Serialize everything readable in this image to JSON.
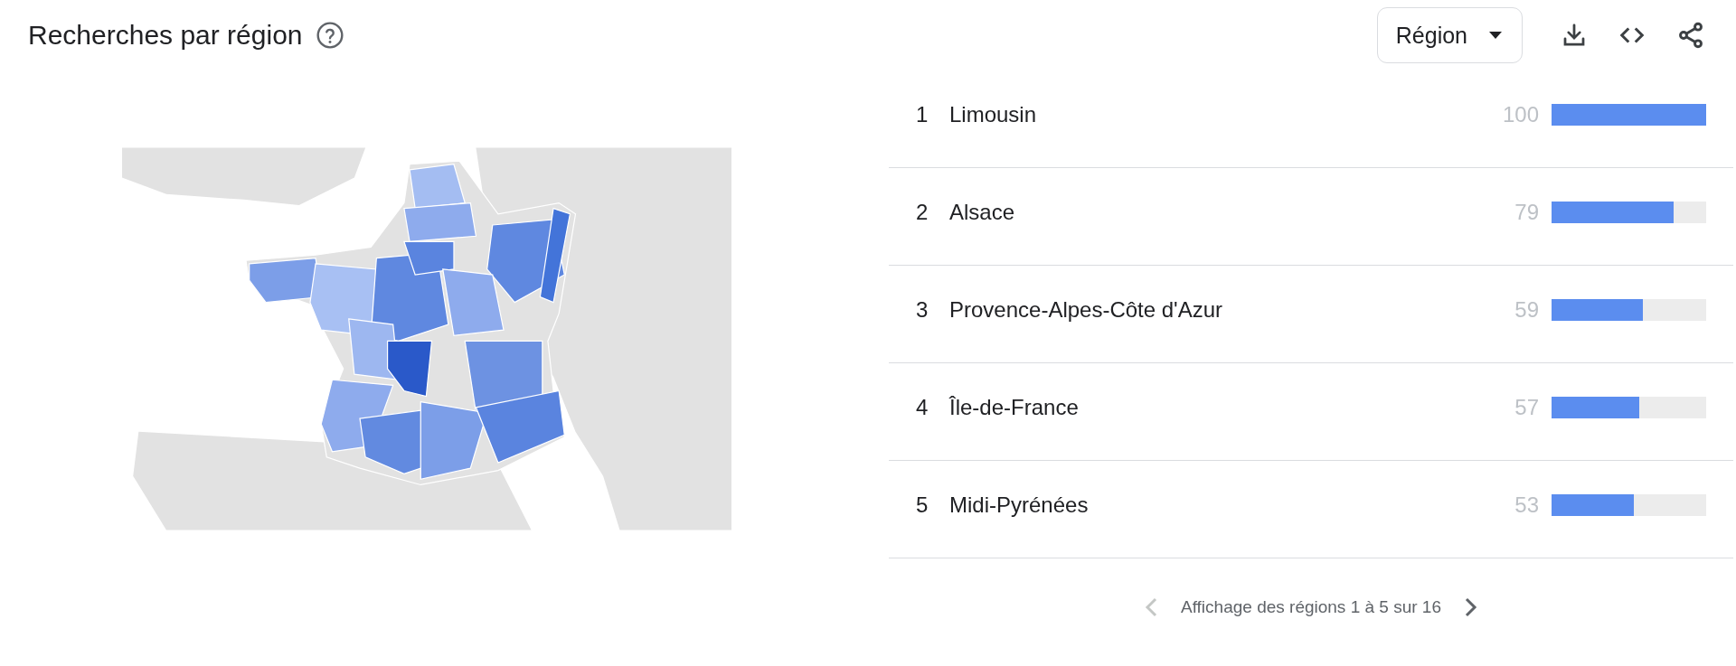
{
  "title": "Recherches par région",
  "filter": {
    "label": "Région"
  },
  "rows": [
    {
      "rank": "1",
      "name": "Limousin",
      "value": "100",
      "level": 1
    },
    {
      "rank": "2",
      "name": "Alsace",
      "value": "79",
      "level": 0.79
    },
    {
      "rank": "3",
      "name": "Provence-Alpes-Côte d'Azur",
      "value": "59",
      "level": 0.59
    },
    {
      "rank": "4",
      "name": "Île-de-France",
      "value": "57",
      "level": 0.57
    },
    {
      "rank": "5",
      "name": "Midi-Pyrénées",
      "value": "53",
      "level": 0.53
    }
  ],
  "pagination": {
    "text": "Affichage des régions 1 à 5 sur 16",
    "prev_disabled": true,
    "next_disabled": false
  }
}
